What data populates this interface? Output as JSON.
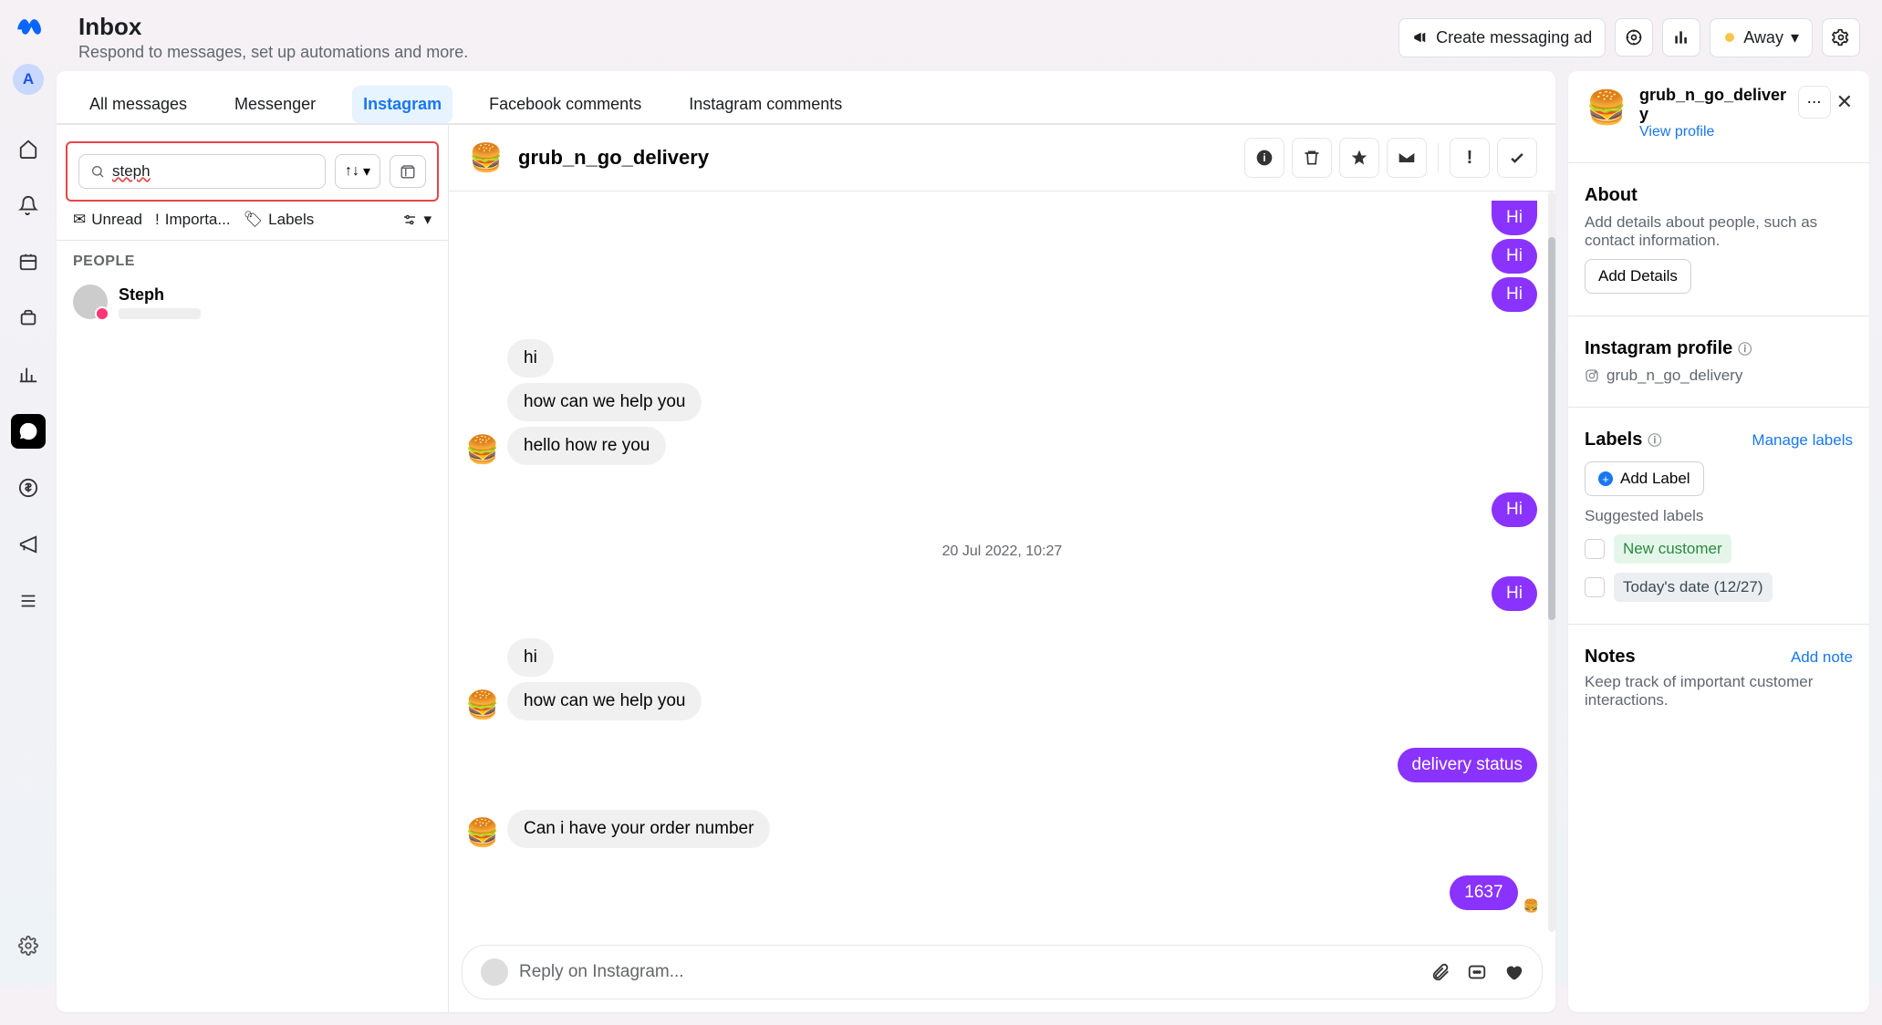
{
  "header": {
    "title": "Inbox",
    "subtitle": "Respond to messages, set up automations and more.",
    "create_ad": "Create messaging ad",
    "status": "Away"
  },
  "rail": {
    "avatar_letter": "A"
  },
  "tabs": {
    "all": "All messages",
    "messenger": "Messenger",
    "instagram": "Instagram",
    "fb_comments": "Facebook comments",
    "ig_comments": "Instagram comments"
  },
  "search": {
    "value": "steph"
  },
  "filters": {
    "unread": "Unread",
    "important": "Importa...",
    "labels": "Labels"
  },
  "people": {
    "header": "PEOPLE",
    "items": [
      {
        "name": "Steph"
      }
    ]
  },
  "chat": {
    "name": "grub_n_go_delivery",
    "timestamp": "20 Jul 2022, 10:27",
    "composer_placeholder": "Reply on Instagram...",
    "messages": {
      "hi_top_1": "Hi",
      "hi_top_2": "Hi",
      "hi_top_3": "Hi",
      "left_hi_1": "hi",
      "left_help_1": "how can we help you",
      "left_hello": "hello how re you",
      "hi_mid_1": "Hi",
      "hi_mid_2": "Hi",
      "left_hi_2": "hi",
      "left_help_2": "how can we help you",
      "right_delivery": "delivery status",
      "left_order": "Can i have your order number",
      "right_num": "1637"
    }
  },
  "profile": {
    "name": "grub_n_go_delivery",
    "view_profile": "View profile",
    "about_title": "About",
    "about_text": "Add details about people, such as contact information.",
    "add_details": "Add Details",
    "ig_title": "Instagram profile",
    "ig_handle": "grub_n_go_delivery",
    "labels_title": "Labels",
    "manage_labels": "Manage labels",
    "add_label": "Add Label",
    "suggested_title": "Suggested labels",
    "sugg_new": "New customer",
    "sugg_date": "Today's date (12/27)",
    "notes_title": "Notes",
    "add_note": "Add note",
    "notes_text": "Keep track of important customer interactions."
  }
}
